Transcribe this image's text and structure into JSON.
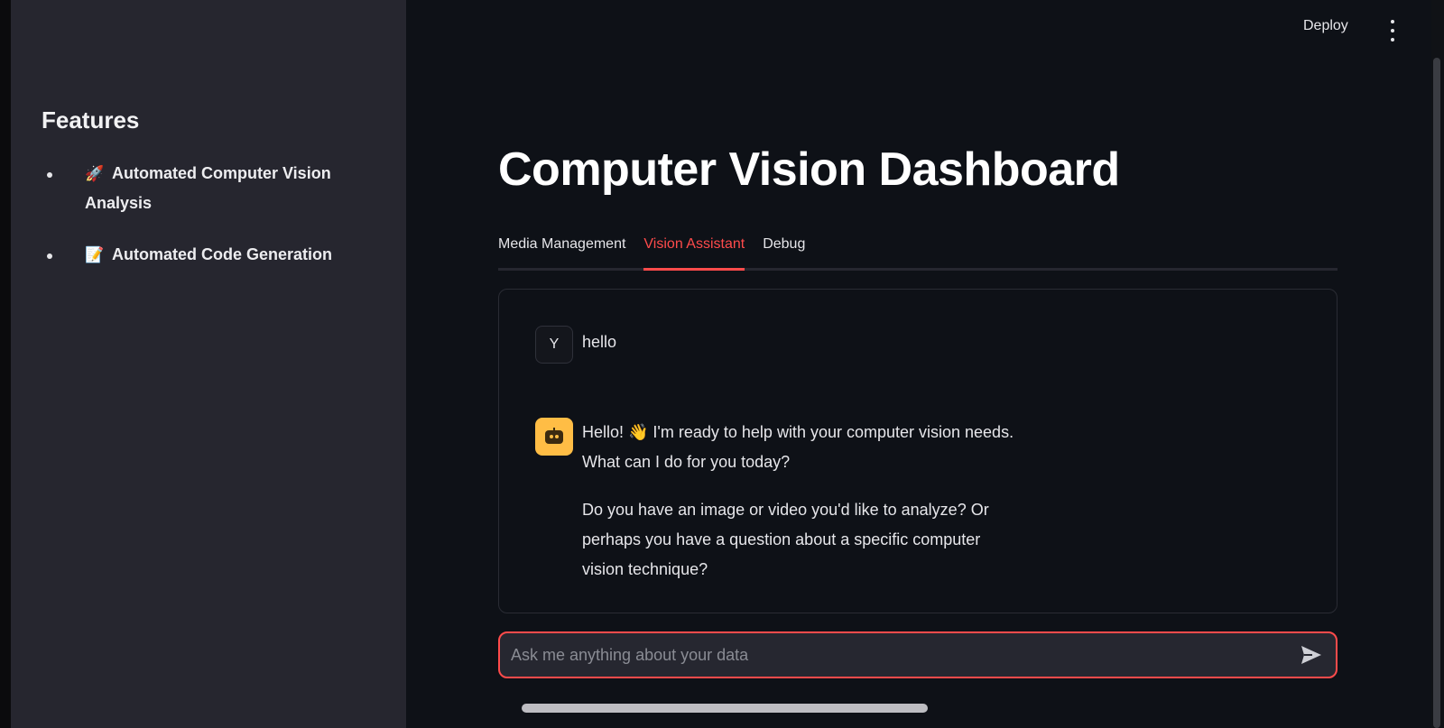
{
  "sidebar": {
    "title": "Features",
    "items": [
      {
        "icon": "rocket-icon",
        "emoji": "🚀",
        "label": "Automated Computer Vision Analysis"
      },
      {
        "icon": "memo-icon",
        "emoji": "📝",
        "label": "Automated Code Generation"
      }
    ]
  },
  "header": {
    "deploy_label": "Deploy",
    "menu_icon": "kebab-menu-icon"
  },
  "main": {
    "title": "Computer Vision Dashboard",
    "tabs": [
      {
        "label": "Media Management",
        "active": false
      },
      {
        "label": "Vision Assistant",
        "active": true
      },
      {
        "label": "Debug",
        "active": false
      }
    ]
  },
  "chat": {
    "messages": [
      {
        "role": "user",
        "avatar_text": "Y",
        "text": "hello"
      },
      {
        "role": "assistant",
        "avatar_icon": "robot-icon",
        "paragraphs": [
          "Hello! 👋 I'm ready to help with your computer vision needs. What can I do for you today?",
          "Do you have an image or video you'd like to analyze? Or perhaps you have a question about a specific computer vision technique?"
        ]
      }
    ],
    "input": {
      "placeholder": "Ask me anything about your data",
      "value": "",
      "send_icon": "send-icon"
    }
  },
  "colors": {
    "accent": "#ff4b4b",
    "sidebar_bg": "#26262f",
    "main_bg": "#0e1117",
    "bot_avatar": "#ffbd45"
  }
}
